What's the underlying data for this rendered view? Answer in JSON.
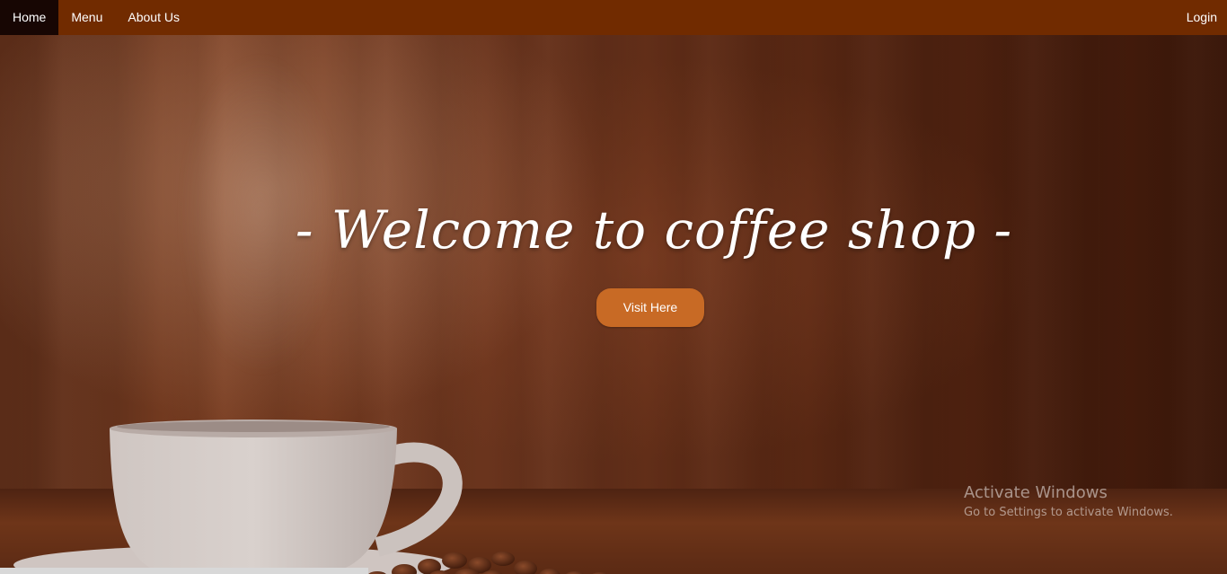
{
  "nav": {
    "items": [
      {
        "label": "Home",
        "active": true
      },
      {
        "label": "Menu",
        "active": false
      },
      {
        "label": "About Us",
        "active": false
      }
    ],
    "login_label": "Login"
  },
  "hero": {
    "title": "- Welcome to coffee shop -",
    "button_label": "Visit Here"
  },
  "watermark": {
    "title": "Activate Windows",
    "subtitle": "Go to Settings to activate Windows."
  },
  "colors": {
    "nav_bg": "#712b00",
    "nav_active_bg": "#170603",
    "button_bg": "#c86a25"
  }
}
